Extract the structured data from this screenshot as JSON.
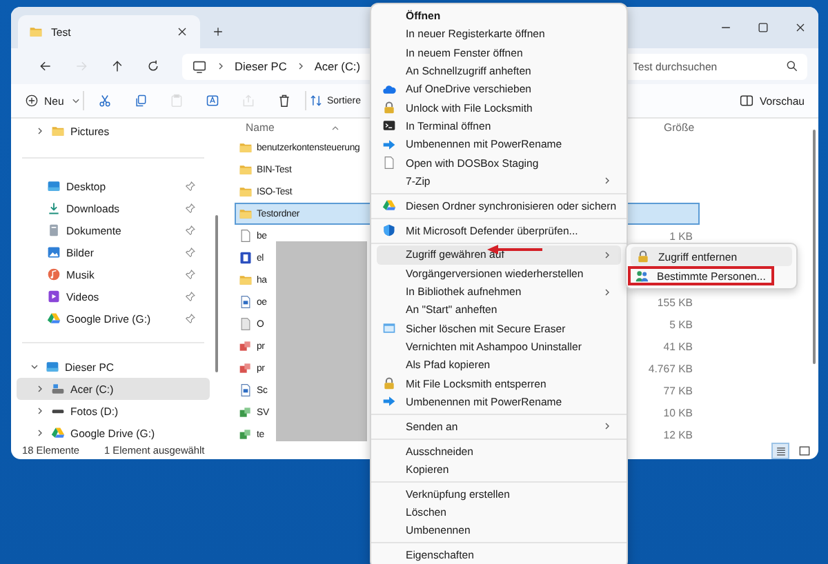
{
  "tab": {
    "title": "Test",
    "selected": true
  },
  "nav": [
    {
      "disabled": false
    },
    {
      "disabled": true
    },
    {
      "disabled": false
    },
    {
      "disabled": false
    }
  ],
  "breadcrumb": [
    "Dieser PC",
    "Acer (C:)"
  ],
  "search": {
    "placeholder": "Test durchsuchen"
  },
  "toolbar": {
    "new": "Neu",
    "actions": [
      {
        "disabled": false
      },
      {
        "disabled": false
      },
      {
        "disabled": true
      },
      {
        "disabled": false
      },
      {
        "disabled": true
      },
      {
        "disabled": false
      }
    ],
    "sort": "Sortiere",
    "preview": "Vorschau"
  },
  "sidebar": {
    "top": [
      {
        "label": "Pictures",
        "expanded": false
      }
    ],
    "quick": [
      {
        "label": "Desktop",
        "pinned": true
      },
      {
        "label": "Downloads",
        "pinned": true
      },
      {
        "label": "Dokumente",
        "pinned": true
      },
      {
        "label": "Bilder",
        "pinned": true
      },
      {
        "label": "Musik",
        "pinned": true
      },
      {
        "label": "Videos",
        "pinned": true
      },
      {
        "label": "Google Drive (G:)",
        "pinned": true
      }
    ],
    "pc": {
      "label": "Dieser PC",
      "expanded": true,
      "children": [
        {
          "label": "Acer (C:)",
          "selected": true,
          "expanded": false
        },
        {
          "label": "Fotos (D:)",
          "selected": false,
          "expanded": false
        },
        {
          "label": "Google Drive (G:)",
          "selected": false,
          "expanded": false
        }
      ]
    }
  },
  "columns": [
    "Name",
    "Größe"
  ],
  "files": [
    {
      "name": "benutzerkontensteuerung",
      "selected": false
    },
    {
      "name": "BIN-Test",
      "selected": false
    },
    {
      "name": "ISO-Test",
      "selected": false
    },
    {
      "name": "Testordner",
      "selected": true
    },
    {
      "name": "be",
      "size": "1 KB",
      "selected": false
    },
    {
      "name": "el",
      "selected": false
    },
    {
      "name": "ha",
      "selected": false
    },
    {
      "name": "oe",
      "size": "155 KB",
      "selected": false
    },
    {
      "name": "O",
      "size": "5 KB",
      "selected": false
    },
    {
      "name": "pr",
      "size": "41 KB",
      "selected": false
    },
    {
      "name": "pr",
      "size": "4.767 KB",
      "selected": false
    },
    {
      "name": "Sc",
      "size": "77 KB",
      "selected": false
    },
    {
      "name": "SV",
      "size": "10 KB",
      "selected": false
    },
    {
      "name": "te",
      "size": "12 KB",
      "selected": false
    }
  ],
  "status": {
    "count": "18 Elemente",
    "selection": "1 Element ausgewählt"
  },
  "views": [
    {
      "selected": true
    },
    {
      "selected": false
    }
  ],
  "context_menu": {
    "groups": [
      [
        {
          "label": "Öffnen",
          "submenu": false,
          "selected": false
        },
        {
          "label": "In neuer Registerkarte öffnen",
          "submenu": false,
          "selected": false
        },
        {
          "label": "In neuem Fenster öffnen",
          "submenu": false,
          "selected": false
        },
        {
          "label": "An Schnellzugriff anheften",
          "submenu": false,
          "selected": false
        },
        {
          "label": "Auf OneDrive verschieben",
          "submenu": false,
          "selected": false
        },
        {
          "label": "Unlock with File Locksmith",
          "submenu": false,
          "selected": false
        },
        {
          "label": "In Terminal öffnen",
          "submenu": false,
          "selected": false
        },
        {
          "label": "Umbenennen mit PowerRename",
          "submenu": false,
          "selected": false
        },
        {
          "label": "Open with DOSBox Staging",
          "submenu": false,
          "selected": false
        },
        {
          "label": "7-Zip",
          "submenu": true,
          "selected": false
        }
      ],
      [
        {
          "label": "Diesen Ordner synchronisieren oder sichern",
          "submenu": false,
          "selected": false
        }
      ],
      [
        {
          "label": "Mit Microsoft Defender überprüfen...",
          "submenu": false,
          "selected": false
        }
      ],
      [
        {
          "label": "Zugriff gewähren auf",
          "submenu": true,
          "selected": true
        },
        {
          "label": "Vorgängerversionen wiederherstellen",
          "submenu": false,
          "selected": false
        },
        {
          "label": "In Bibliothek aufnehmen",
          "submenu": true,
          "selected": false
        },
        {
          "label": "An \"Start\" anheften",
          "submenu": false,
          "selected": false
        },
        {
          "label": "Sicher löschen mit Secure Eraser",
          "submenu": false,
          "selected": false
        },
        {
          "label": "Vernichten mit Ashampoo Uninstaller",
          "submenu": false,
          "selected": false
        },
        {
          "label": "Als Pfad kopieren",
          "submenu": false,
          "selected": false
        },
        {
          "label": "Mit File Locksmith entsperren",
          "submenu": false,
          "selected": false
        },
        {
          "label": "Umbenennen mit PowerRename",
          "submenu": false,
          "selected": false
        }
      ],
      [
        {
          "label": "Senden an",
          "submenu": true,
          "selected": false
        }
      ],
      [
        {
          "label": "Ausschneiden",
          "submenu": false,
          "selected": false
        },
        {
          "label": "Kopieren",
          "submenu": false,
          "selected": false
        }
      ],
      [
        {
          "label": "Verknüpfung erstellen",
          "submenu": false,
          "selected": false
        },
        {
          "label": "Löschen",
          "submenu": false,
          "selected": false
        },
        {
          "label": "Umbenennen",
          "submenu": false,
          "selected": false
        }
      ],
      [
        {
          "label": "Eigenschaften",
          "submenu": false,
          "selected": false
        }
      ]
    ]
  },
  "submenu": {
    "items": [
      {
        "label": "Zugriff entfernen"
      },
      {
        "label": "Bestimmte Personen..."
      }
    ]
  }
}
